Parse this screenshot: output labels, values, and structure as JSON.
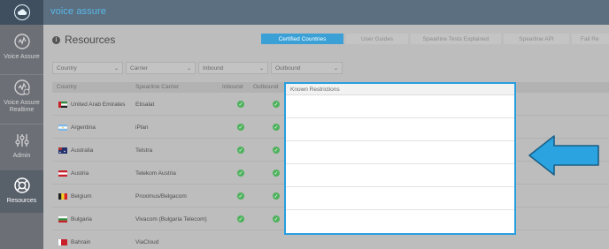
{
  "app": {
    "title": "voice assure"
  },
  "sidebar": {
    "items": [
      {
        "label": "Voice Assure",
        "icon": "voice-assure-icon"
      },
      {
        "label": "Voice Assure Realtime",
        "icon": "realtime-icon"
      },
      {
        "label": "Admin",
        "icon": "sliders-icon"
      },
      {
        "label": "Resources",
        "icon": "lifebuoy-icon",
        "active": true
      }
    ]
  },
  "page": {
    "title": "Resources",
    "title_icon": "info-icon"
  },
  "tabs": [
    {
      "label": "Certified Countries",
      "active": true
    },
    {
      "label": "User Guides"
    },
    {
      "label": "Spearline Tests Explained"
    },
    {
      "label": "Spearline API"
    },
    {
      "label": "Fail Re"
    }
  ],
  "filters": [
    {
      "label": "Country"
    },
    {
      "label": "Carrier"
    },
    {
      "label": "Inbound"
    },
    {
      "label": "Outbound"
    }
  ],
  "table": {
    "columns": {
      "country": "Country",
      "carrier": "Spearline Carrier",
      "inbound": "Inbound",
      "outbound": "Outbound",
      "restrictions": "Known Restrictions"
    },
    "rows": [
      {
        "country": "United Arab Emirates",
        "carrier": "Etisalat",
        "flag": "uae"
      },
      {
        "country": "Argentina",
        "carrier": "iPlan",
        "flag": "argentina"
      },
      {
        "country": "Australia",
        "carrier": "Telstra",
        "flag": "australia"
      },
      {
        "country": "Austria",
        "carrier": "Telekom Austria",
        "flag": "austria"
      },
      {
        "country": "Belgium",
        "carrier": "Proximus/Belgacom",
        "flag": "belgium"
      },
      {
        "country": "Bulgaria",
        "carrier": "Vivacom (Bulgaria Telecom)",
        "flag": "bulgaria"
      },
      {
        "country": "Bahrain",
        "carrier": "ViaCloud",
        "flag": "bahrain"
      }
    ]
  },
  "colors": {
    "accent": "#3aa0d6",
    "highlight_border": "#2a9fde",
    "arrow": "#2aa3e0",
    "check": "#4eb25d"
  }
}
